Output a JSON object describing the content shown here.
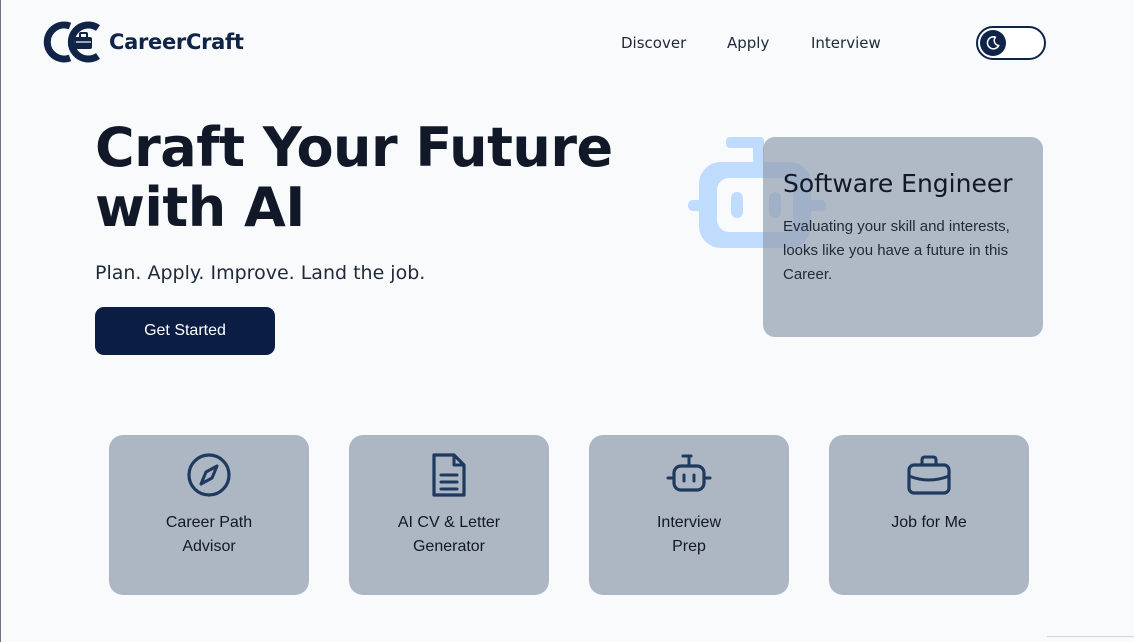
{
  "brand": {
    "name": "CareerCraft",
    "color": "#0f2447"
  },
  "nav": {
    "items": [
      "Discover",
      "Apply",
      "Interview"
    ]
  },
  "theme_toggle": {
    "icon": "moon-icon",
    "state": "dark-mode-off"
  },
  "hero": {
    "title_line1": "Craft Your Future",
    "title_line2": "with AI",
    "subtitle": "Plan. Apply. Improve. Land the job.",
    "cta_label": "Get Started"
  },
  "career_card": {
    "title": "Software Engineer",
    "description": "Evaluating your skill and interests, looks like you have a future in this Career."
  },
  "features": [
    {
      "icon": "compass-icon",
      "line1": "Career Path",
      "line2": "Advisor"
    },
    {
      "icon": "document-icon",
      "line1": "AI CV & Letter",
      "line2": "Generator"
    },
    {
      "icon": "robot-icon",
      "line1": "Interview",
      "line2": "Prep"
    },
    {
      "icon": "briefcase-icon",
      "line1": "Job for Me",
      "line2": ""
    }
  ],
  "colors": {
    "background": "#f8fafc",
    "primary": "#0b1d42",
    "card": "#adb6c3",
    "robot_accent": "#bfdbfe"
  }
}
